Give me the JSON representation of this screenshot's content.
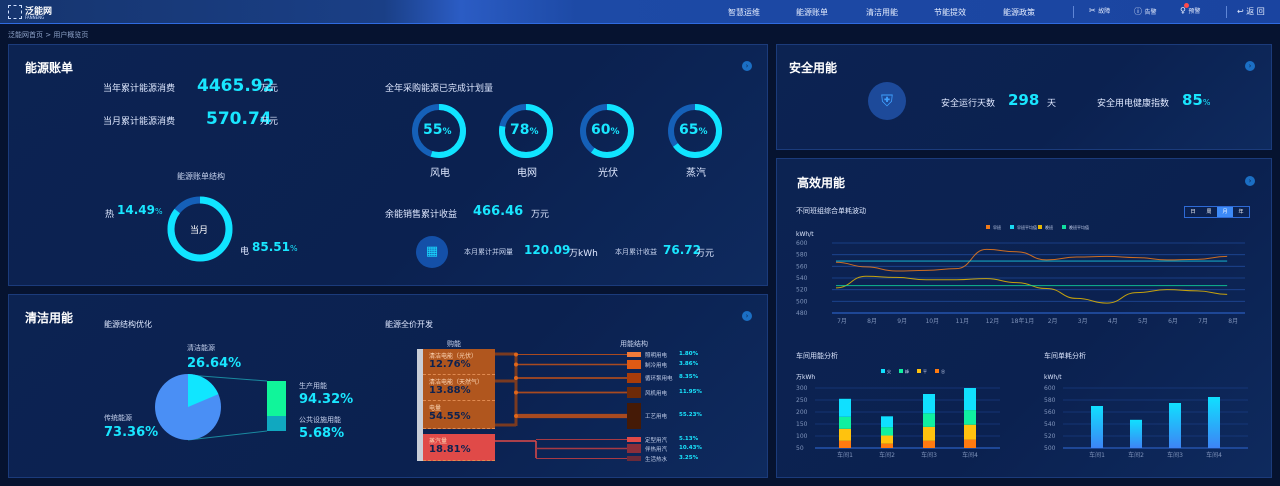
{
  "header": {
    "logo_text": "泛能网",
    "logo_sub": "FANNENG",
    "nav": [
      "智慧运维",
      "能源账单",
      "清洁用能",
      "节能提效",
      "能源政策"
    ],
    "actions": [
      {
        "icon": "fault-icon",
        "label": "故障"
      },
      {
        "icon": "alarm-icon",
        "label": "告警"
      },
      {
        "icon": "warning-icon",
        "label": "预警"
      }
    ],
    "back": "返 回"
  },
  "breadcrumb": "泛能网首页 > 用户概览页",
  "bill": {
    "title": "能源账单",
    "year_label": "当年累计能源消费",
    "year_value": "4465.92",
    "year_unit": "万元",
    "month_label": "当月累计能源消费",
    "month_value": "570.74",
    "month_unit": "万元",
    "structure_title": "能源账单结构",
    "center": "当月",
    "heat_label": "热",
    "heat_value": "14.49",
    "elec_label": "电",
    "elec_value": "85.51",
    "pct": "%",
    "plan_title": "全年采购能源已完成计划量",
    "plans": [
      {
        "name": "风电",
        "value": 55
      },
      {
        "name": "电网",
        "value": 78
      },
      {
        "name": "光伏",
        "value": 60
      },
      {
        "name": "蒸汽",
        "value": 65
      }
    ],
    "surplus_label": "余能销售累计收益",
    "surplus_value": "466.46",
    "surplus_unit": "万元",
    "grid_label": "本月累计并网量",
    "grid_value": "120.09",
    "grid_unit": "万kWh",
    "income_label": "本月累计收益",
    "income_value": "76.72",
    "income_unit": "万元"
  },
  "clean": {
    "title": "清洁用能",
    "opt_title": "能源结构优化",
    "clean_label": "清洁能源",
    "clean_value": "26.64%",
    "trad_label": "传统能源",
    "trad_value": "73.36%",
    "prod_label": "生产用能",
    "prod_value": "94.32%",
    "pub_label": "公共设施用能",
    "pub_value": "5.68%",
    "sankey_title": "能源全价开发",
    "buy_title": "购能",
    "use_title": "用能结构",
    "sources": [
      {
        "name": "清洁电能（光伏）",
        "value": "12.76%"
      },
      {
        "name": "清洁电能（天然气）",
        "value": "13.88%"
      },
      {
        "name": "电量",
        "value": "54.55%"
      },
      {
        "name": "蒸汽量",
        "value": "18.81%"
      }
    ],
    "uses": [
      {
        "name": "照明用电",
        "value": "1.80%"
      },
      {
        "name": "制冷用电",
        "value": "3.86%"
      },
      {
        "name": "循环泵用电",
        "value": "8.35%"
      },
      {
        "name": "风机用电",
        "value": "11.95%"
      },
      {
        "name": "工艺用电",
        "value": "55.23%"
      },
      {
        "name": "定型用汽",
        "value": "5.13%"
      },
      {
        "name": "伴热用汽",
        "value": "10.43%"
      },
      {
        "name": "生活热水",
        "value": "3.25%"
      }
    ]
  },
  "safety": {
    "title": "安全用能",
    "days_label": "安全运行天数",
    "days_value": "298",
    "days_unit": "天",
    "index_label": "安全用电健康指数",
    "index_value": "85",
    "index_unit": "%"
  },
  "efficiency": {
    "title": "高效用能",
    "period_tabs": [
      "日",
      "周",
      "月",
      "年"
    ],
    "active_tab": "月"
  },
  "chart_data": [
    {
      "type": "line",
      "title": "不同班组综合单耗波动",
      "ylabel": "kWh/t",
      "ylim": [
        480,
        600
      ],
      "yticks": [
        600,
        580,
        560,
        540,
        520,
        500,
        480
      ],
      "categories": [
        "7月",
        "8月",
        "9月",
        "10月",
        "11月",
        "12月",
        "18年1月",
        "2月",
        "3月",
        "4月",
        "5月",
        "6月",
        "7月",
        "8月"
      ],
      "series": [
        {
          "name": "早班",
          "color": "#f07a1a",
          "values": [
            567,
            559,
            552,
            553,
            556,
            589,
            585,
            571,
            576,
            577,
            575,
            571,
            572,
            577
          ]
        },
        {
          "name": "早班平均值",
          "color": "#19d8f0",
          "values": [
            569,
            569,
            569,
            569,
            569,
            569,
            569,
            569,
            569,
            569,
            569,
            569,
            569,
            569
          ]
        },
        {
          "name": "晚班",
          "color": "#e8b800",
          "values": [
            523,
            543,
            541,
            537,
            537,
            539,
            532,
            522,
            505,
            497,
            515,
            520,
            518,
            512
          ]
        },
        {
          "name": "晚班平均值",
          "color": "#10e0a0",
          "values": [
            527,
            527,
            527,
            527,
            527,
            527,
            527,
            527,
            527,
            527,
            527,
            527,
            527,
            527
          ]
        }
      ]
    },
    {
      "type": "bar",
      "stacked": true,
      "title": "车间用能分析",
      "ylabel": "万kWh",
      "ylim": [
        50,
        300
      ],
      "yticks": [
        300,
        250,
        200,
        150,
        100,
        50
      ],
      "categories": [
        "车间1",
        "车间2",
        "车间3",
        "车间4"
      ],
      "series": [
        {
          "name": "谷",
          "color": "#ff7a10",
          "values": [
            30,
            18,
            30,
            35
          ]
        },
        {
          "name": "平",
          "color": "#ffc20e",
          "values": [
            50,
            34,
            58,
            62
          ]
        },
        {
          "name": "峰",
          "color": "#10f0a0",
          "values": [
            50,
            35,
            57,
            61
          ]
        },
        {
          "name": "尖",
          "color": "#10e0ff",
          "values": [
            75,
            45,
            80,
            92
          ]
        }
      ],
      "legend_order": [
        "尖",
        "峰",
        "平",
        "谷"
      ]
    },
    {
      "type": "bar",
      "title": "车间单耗分析",
      "ylabel": "kWh/t",
      "ylim": [
        500,
        600
      ],
      "yticks": [
        600,
        580,
        560,
        540,
        520,
        500
      ],
      "categories": [
        "车间1",
        "车间2",
        "车间3",
        "车间4"
      ],
      "values": [
        570,
        547,
        575,
        585
      ]
    }
  ]
}
